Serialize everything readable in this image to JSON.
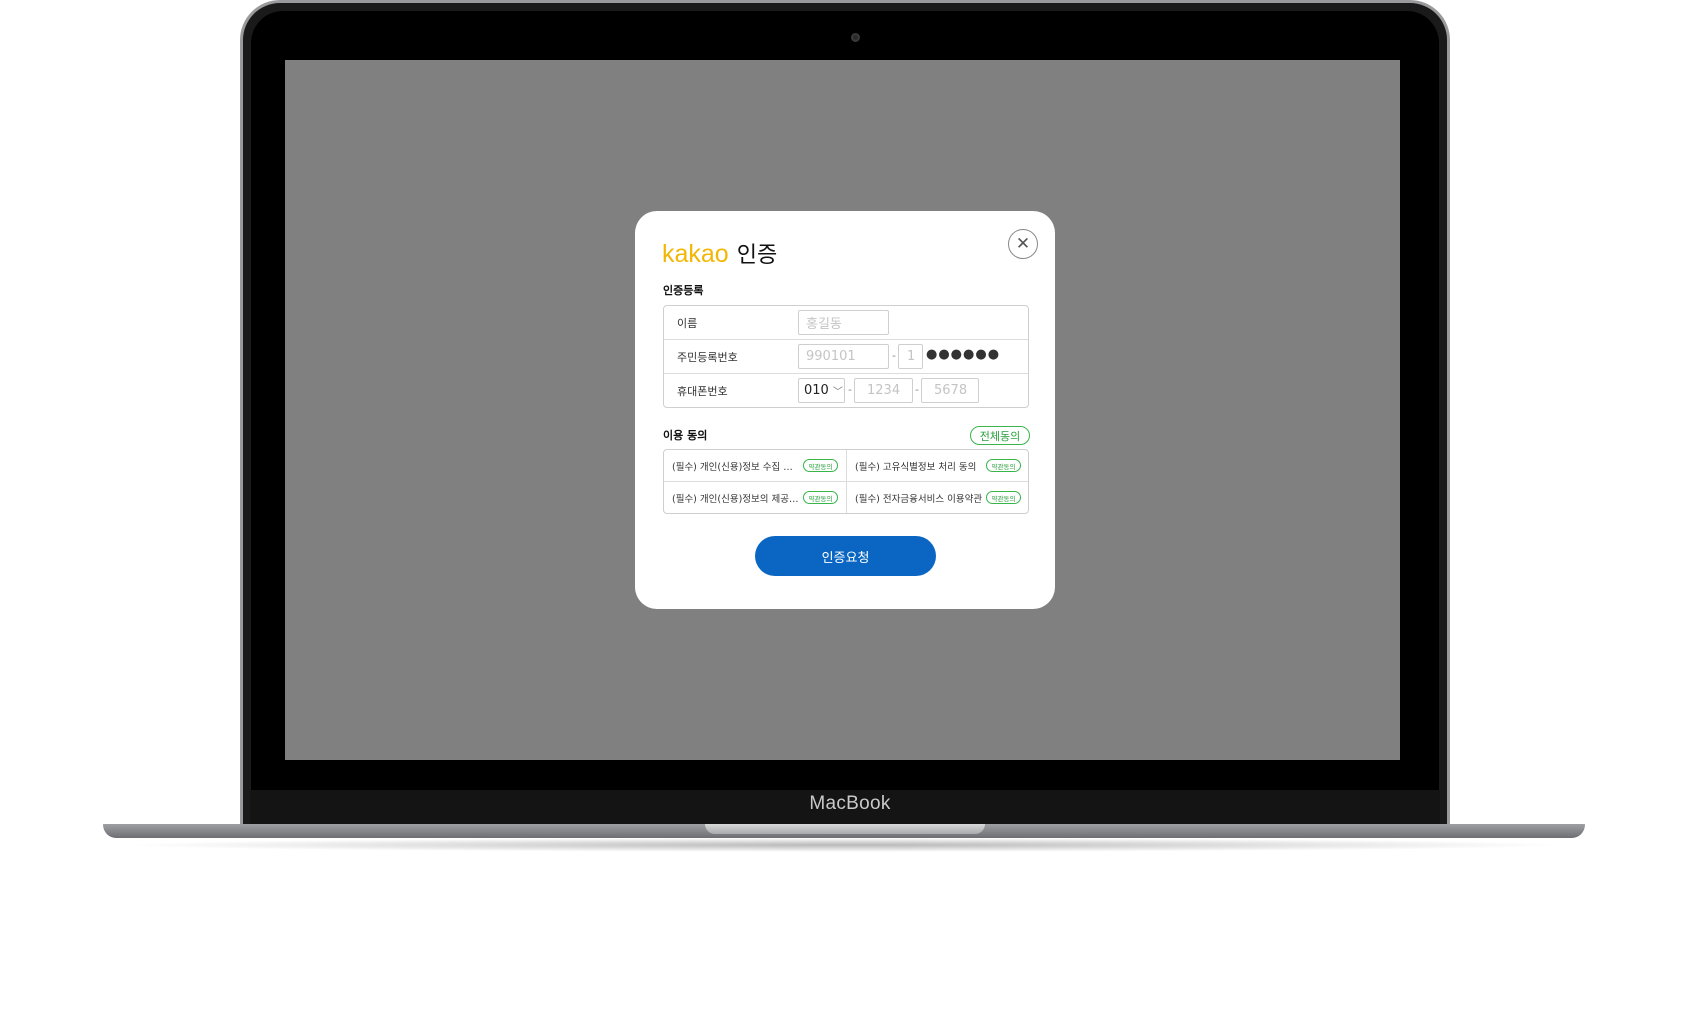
{
  "device": {
    "brand_label": "MacBook"
  },
  "modal": {
    "brand": "kakao",
    "title": "인증",
    "registration": {
      "section_label": "인증등록",
      "name": {
        "label": "이름",
        "placeholder": "홍길동"
      },
      "resident_id": {
        "label": "주민등록번호",
        "front_placeholder": "990101",
        "back_first_placeholder": "1",
        "masked": "●●●●●●",
        "separator": "-"
      },
      "phone": {
        "label": "휴대폰번호",
        "prefix": "010",
        "middle_placeholder": "1234",
        "last_placeholder": "5678",
        "separator": "-"
      }
    },
    "agreement": {
      "section_label": "이용 동의",
      "all_agree_label": "전체동의",
      "items": [
        {
          "text": "(필수) 개인(신용)정보 수집 및 이용 동의",
          "button": "약관동의"
        },
        {
          "text": "(필수) 고유식별정보 처리 동의",
          "button": "약관동의"
        },
        {
          "text": "(필수) 개인(신용)정보의 제공에 관한 동의",
          "button": "약관동의"
        },
        {
          "text": "(필수) 전자금융서비스 이용약관",
          "button": "약관동의"
        }
      ]
    },
    "submit_label": "인증요청",
    "close_icon": "close-icon"
  },
  "colors": {
    "brand_yellow": "#f2b705",
    "accent_green": "#39b54a",
    "primary_blue": "#0a66c2",
    "screen_gray": "#808080"
  }
}
